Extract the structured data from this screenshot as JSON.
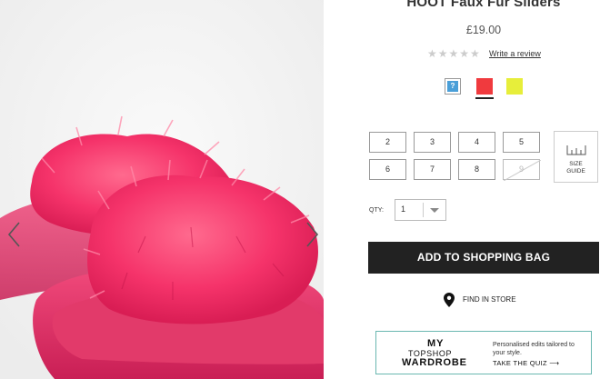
{
  "product": {
    "title": "HOOT Faux Fur Sliders",
    "price": "£19.00",
    "rating_stars": 0,
    "rating_max": 5,
    "rating_glyphs": "★★★★★",
    "write_review_label": "Write a review"
  },
  "colours": {
    "swatches": [
      {
        "name": "unknown",
        "icon": "question-mark-icon",
        "label": "?"
      },
      {
        "name": "pink",
        "color": "#f03a3e",
        "selected": true
      },
      {
        "name": "yellow",
        "color": "#e7ee3a",
        "selected": false
      }
    ]
  },
  "sizes": {
    "options": [
      {
        "label": "2",
        "available": true
      },
      {
        "label": "3",
        "available": true
      },
      {
        "label": "4",
        "available": true
      },
      {
        "label": "5",
        "available": true
      },
      {
        "label": "6",
        "available": true
      },
      {
        "label": "7",
        "available": true
      },
      {
        "label": "8",
        "available": true
      },
      {
        "label": "9",
        "available": false
      }
    ],
    "guide_label": "SIZE GUIDE",
    "guide_icon": "ruler-icon"
  },
  "quantity": {
    "label": "QTY:",
    "value": "1"
  },
  "actions": {
    "add_to_bag": "ADD TO SHOPPING BAG",
    "find_in_store": "FIND IN STORE",
    "find_icon": "map-pin-icon"
  },
  "banner": {
    "line1": "MY",
    "line2": "TOPSHOP",
    "line3": "WARDROBE",
    "description": "Personalised edits tailored to your style.",
    "cta": "TAKE THE QUIZ ⟶"
  },
  "gallery": {
    "prev_icon": "chevron-left-icon",
    "next_icon": "chevron-right-icon",
    "image": "pink-faux-fur-slider-photo"
  },
  "colors": {
    "button_dark": "#222222",
    "banner_border": "#6ab7b0",
    "fur_pink": "#f5336a"
  }
}
